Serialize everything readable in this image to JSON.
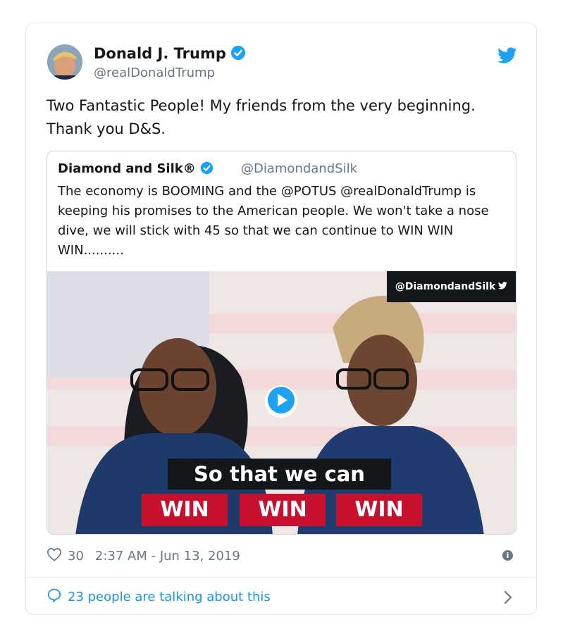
{
  "tweet": {
    "author_name": "Donald J. Trump",
    "author_handle": "@realDonaldTrump",
    "text": "Two Fantastic People! My friends from the very beginning. Thank you D&S.",
    "likes": "30",
    "timestamp": "2:37 AM - Jun 13, 2019",
    "talking": "23 people are talking about this"
  },
  "quoted": {
    "author_name": "Diamond and Silk®",
    "author_handle": "@DiamondandSilk",
    "text": "The economy is BOOMING and the @POTUS @realDonaldTrump is keeping his promises to the American people. We won't take a nose dive, we will stick with 45 so that we can continue to WIN WIN WIN..........",
    "media": {
      "handle_banner": "@DiamondandSilk",
      "caption": "So that we can",
      "win_labels": [
        "WIN",
        "WIN",
        "WIN"
      ]
    }
  },
  "icons": {
    "verified": "verified-badge-icon",
    "brand": "twitter-bird-icon",
    "like": "heart-icon",
    "info": "info-icon",
    "reply": "reply-bubble-icon",
    "chevron": "chevron-right-icon",
    "play": "play-icon"
  },
  "colors": {
    "accent": "#1b95e0",
    "verified": "#1da1f2",
    "muted": "#657786",
    "win_red": "#c8102e"
  }
}
